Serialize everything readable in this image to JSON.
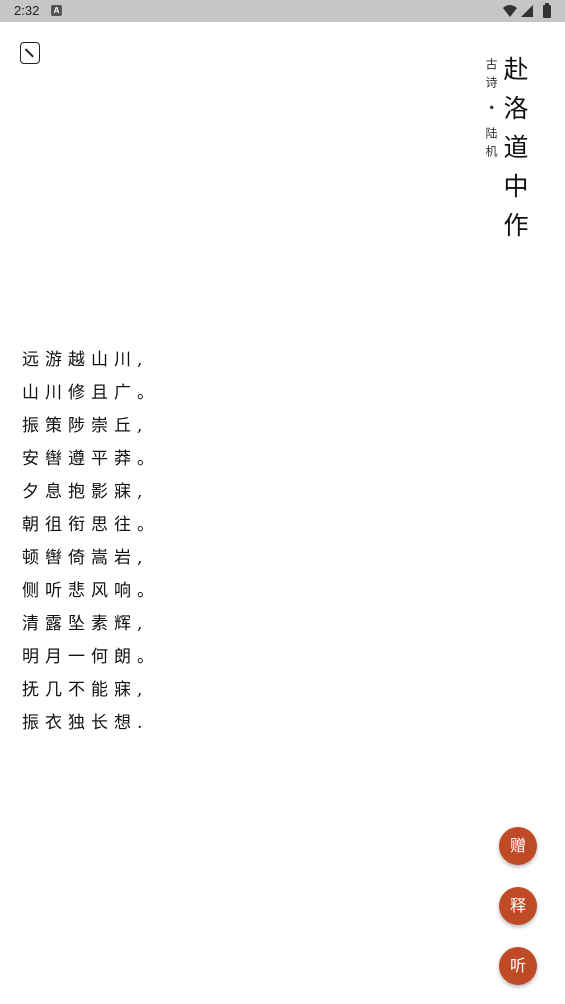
{
  "status_bar": {
    "time": "2:32",
    "notification_icon": "a-icon"
  },
  "title": "赴洛道中作",
  "meta": "古诗 • 陆机",
  "poem_lines": [
    "远游越山川,",
    "山川修且广。",
    "振策陟崇丘,",
    "安辔遵平莽。",
    "夕息抱影寐,",
    "朝徂衔思往。",
    "顿辔倚嵩岩,",
    "侧听悲风响。",
    "清露坠素辉,",
    "明月一何朗。",
    "抚几不能寐,",
    "振衣独长想."
  ],
  "buttons": {
    "gift": "赠",
    "explain": "释",
    "listen": "听"
  },
  "colors": {
    "accent": "#bf4a26",
    "status_bar": "#c6c6c6"
  }
}
